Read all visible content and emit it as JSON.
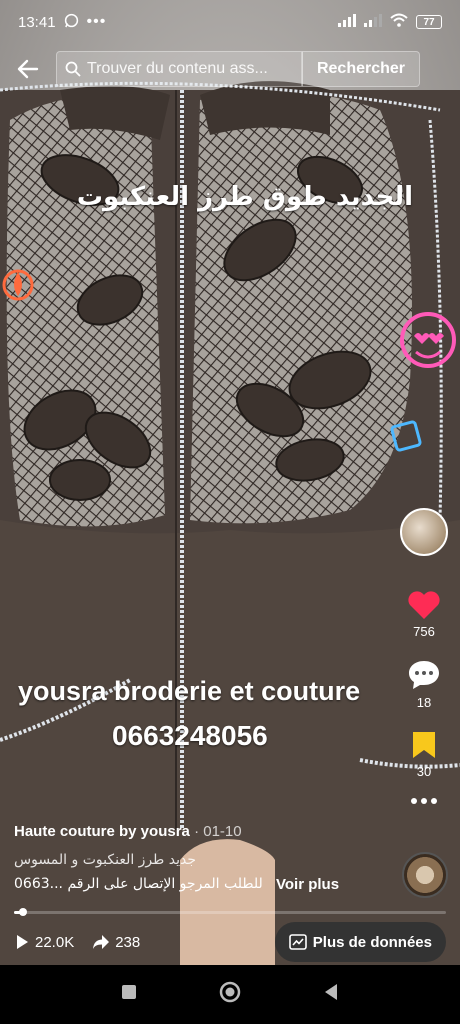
{
  "status_bar": {
    "time": "13:41",
    "battery": "77"
  },
  "search": {
    "placeholder": "Trouver du contenu ass...",
    "button_label": "Rechercher"
  },
  "video": {
    "caption_arabic": "الجديد طوق طرز العنكبوت",
    "brand_line1": "yousra broderie et couture",
    "brand_line2": "0663248056"
  },
  "actions": {
    "likes": "756",
    "comments": "18",
    "saves": "30"
  },
  "post": {
    "author": "Haute couture by yousra",
    "date": "· 01-10",
    "description_line1": "جديد طرز العنكبوت و المسوس",
    "description_line2": "0663... للطلب المرجو الإتصال على الرقم",
    "see_more": "Voir plus",
    "progress": 0.02
  },
  "stats": {
    "views": "22.0K",
    "shares": "238",
    "more_data_label": "Plus de données"
  },
  "colors": {
    "like": "#fe2c55",
    "save": "#f8c81c",
    "fabric": "#4a403b"
  }
}
